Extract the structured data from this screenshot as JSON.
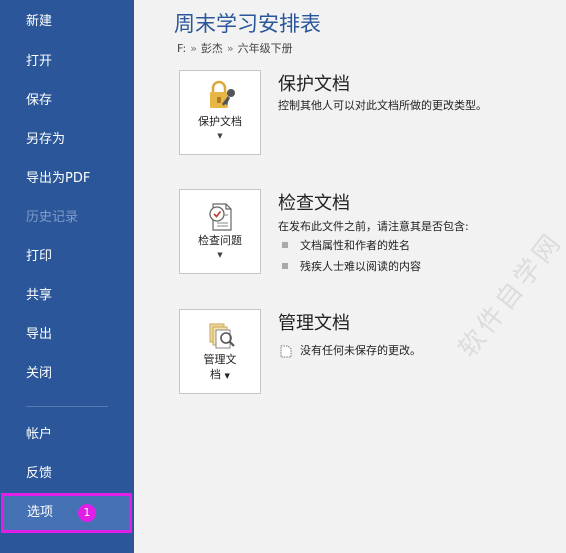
{
  "sidebar": {
    "items": [
      {
        "label": "新建"
      },
      {
        "label": "打开"
      },
      {
        "label": "保存"
      },
      {
        "label": "另存为"
      },
      {
        "label": "导出为PDF"
      },
      {
        "label": "历史记录"
      },
      {
        "label": "打印"
      },
      {
        "label": "共享"
      },
      {
        "label": "导出"
      },
      {
        "label": "关闭"
      },
      {
        "label": "帐户"
      },
      {
        "label": "反馈"
      },
      {
        "label": "选项"
      }
    ],
    "options_badge": "1",
    "color": "#2b579a",
    "highlight_color": "#e020e6"
  },
  "document": {
    "title": "周末学习安排表",
    "breadcrumb": [
      "F:",
      "彭杰",
      "六年级下册"
    ],
    "breadcrumb_sep": "»"
  },
  "sections": {
    "protect": {
      "tile_label": "保护文档",
      "heading": "保护文档",
      "description": "控制其他人可以对此文档所做的更改类型。"
    },
    "inspect": {
      "tile_label": "检查问题",
      "heading": "检查文档",
      "description": "在发布此文件之前，请注意其是否包含:",
      "bullets": [
        "文档属性和作者的姓名",
        "残疾人士难以阅读的内容"
      ]
    },
    "manage": {
      "tile_label_1": "管理文",
      "tile_label_2": "档",
      "heading": "管理文档",
      "description": "没有任何未保存的更改。"
    }
  },
  "watermark": "软件自学网"
}
